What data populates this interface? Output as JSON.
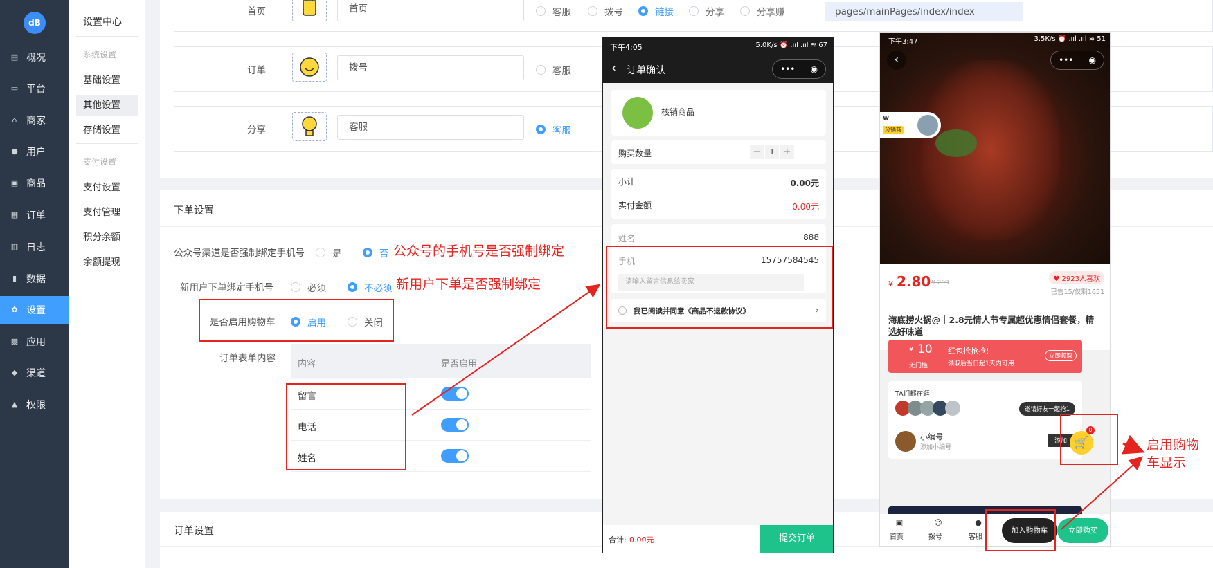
{
  "app": {
    "logo_text": "dб"
  },
  "sidebar": {
    "items": [
      {
        "label": "概况",
        "icon": "dashboard-icon",
        "glyph": "▤"
      },
      {
        "label": "平台",
        "icon": "monitor-icon",
        "glyph": "▭"
      },
      {
        "label": "商家",
        "icon": "store-icon",
        "glyph": "⌂"
      },
      {
        "label": "用户",
        "icon": "user-icon",
        "glyph": "●"
      },
      {
        "label": "商品",
        "icon": "goods-icon",
        "glyph": "▣"
      },
      {
        "label": "订单",
        "icon": "order-icon",
        "glyph": "▦"
      },
      {
        "label": "日志",
        "icon": "log-icon",
        "glyph": "▥"
      },
      {
        "label": "数据",
        "icon": "chart-icon",
        "glyph": "▮"
      },
      {
        "label": "设置",
        "icon": "gear-icon",
        "glyph": "✿"
      },
      {
        "label": "应用",
        "icon": "apps-icon",
        "glyph": "▩"
      },
      {
        "label": "渠道",
        "icon": "channel-icon",
        "glyph": "◆"
      },
      {
        "label": "权限",
        "icon": "lock-icon",
        "glyph": "▲"
      }
    ]
  },
  "submenu": {
    "title": "设置中心",
    "group1": "系统设置",
    "items1": [
      "基础设置",
      "其他设置",
      "存储设置"
    ],
    "group2": "支付设置",
    "items2": [
      "支付设置",
      "支付管理",
      "积分余额",
      "余额提现"
    ]
  },
  "nav_rows": [
    {
      "label": "首页",
      "input": "首页",
      "options": [
        "客服",
        "拨号",
        "链接",
        "分享",
        "分享赚"
      ],
      "selected": 2,
      "path": "pages/mainPages/index/index"
    },
    {
      "label": "订单",
      "input": "拨号",
      "options": [
        "客服"
      ],
      "selected": -1
    },
    {
      "label": "分享",
      "input": "客服",
      "options": [
        "客服"
      ],
      "selected": 0
    }
  ],
  "order_settings": {
    "title": "下单设置",
    "force_bind_label": "公众号渠道是否强制绑定手机号",
    "force_bind_options": [
      "是",
      "否"
    ],
    "new_user_label": "新用户下单绑定手机号",
    "new_user_options": [
      "必须",
      "不必须"
    ],
    "cart_label": "是否启用购物车",
    "cart_options": [
      "启用",
      "关闭"
    ],
    "form_label": "订单表单内容",
    "table_headers": [
      "内容",
      "是否启用"
    ],
    "table_rows": [
      {
        "name": "留言",
        "enabled": true
      },
      {
        "name": "电话",
        "enabled": true
      },
      {
        "name": "姓名",
        "enabled": true
      }
    ],
    "note1": "公众号的手机号是否强制绑定",
    "note2": "新用户下单是否强制绑定"
  },
  "order_section": {
    "title": "订单设置"
  },
  "phone1": {
    "time": "下午4:05",
    "status": "5.0K/s ⏰ .ııl .ııl ≋ 67",
    "title": "订单确认",
    "product": "核销商品",
    "qty_label": "购买数量",
    "qty": "1",
    "subtotal_label": "小计",
    "subtotal": "0.00元",
    "paid_label": "实付金额",
    "paid": "0.00元",
    "name_label": "姓名",
    "name_value": "888",
    "phone_label": "手机",
    "phone_value": "15757584545",
    "message_placeholder": "请输入留言信息给卖家",
    "agree": "我已阅读并同意《商品不退款协议》",
    "total_label": "合计:",
    "total_value": "0.00元",
    "submit": "提交订单"
  },
  "phone2": {
    "time": "下午3:47",
    "status": "3.5K/s ⏰ .ııl .ııl ≋ 51",
    "seller_name": "w",
    "seller_tag": "分销商",
    "price_symbol": "¥",
    "price": "2.80",
    "orig_price": "¥ 299",
    "likes": "2923人喜欢",
    "sold": "已售15/仅剩1651",
    "product_title": "海底捞火锅@｜2.8元情人节专属超优惠情侣套餐，精选好味道",
    "coupon_symbol": "¥",
    "coupon_value": "10",
    "coupon_cond": "无门槛",
    "coupon_title": "红包抢抢抢!",
    "coupon_desc": "领取后当日起1天内可用",
    "coupon_btn": "立即领取",
    "browsing_title": "TA们都在逛",
    "invite": "邀请好友一起抢1",
    "cart_badge": "0",
    "shop_name": "小编号",
    "shop_sub": "添加小编号",
    "add_btn": "添加",
    "tab_home": "首页",
    "tab_dial": "拨号",
    "tab_service": "客服",
    "add_cart": "加入购物车",
    "buy_now": "立即购买",
    "note": "启用购物车显示"
  },
  "colors": {
    "accent": "#409eff",
    "red": "#e5231f",
    "green": "#1ec28b",
    "sidebar": "#2c3847"
  }
}
